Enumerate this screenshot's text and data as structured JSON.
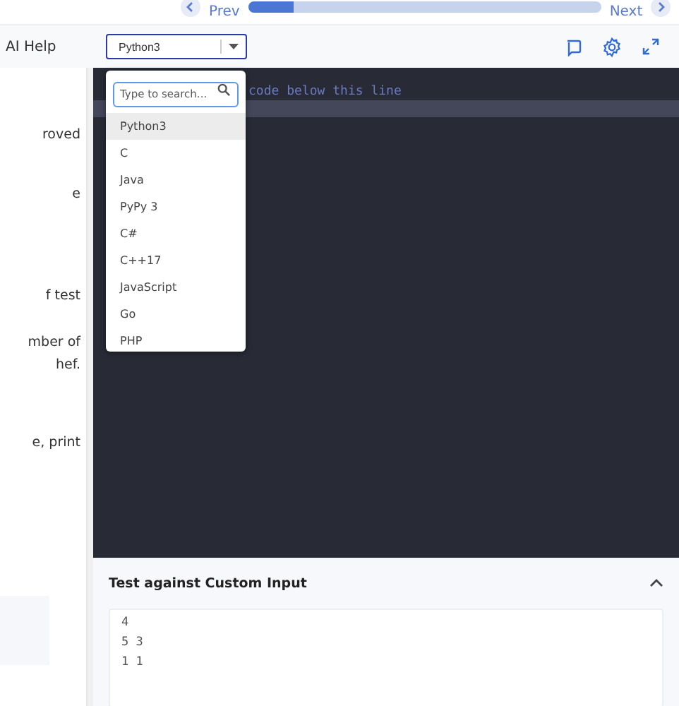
{
  "nav": {
    "prev": "Prev",
    "next": "Next",
    "progress": {
      "level": 0.13
    }
  },
  "header": {
    "ai_help": "AI Help",
    "language_select": {
      "value": "Python3"
    }
  },
  "problem_text": [
    "roved",
    "e",
    "f test",
    "mber of",
    "hef.",
    "e, print"
  ],
  "editor": {
    "lines": [
      {
        "text": "code below this line",
        "current": false
      },
      {
        "current": true
      }
    ]
  },
  "language_dropdown": {
    "search": {
      "placeholder": "Type to search..."
    },
    "options": [
      {
        "label": "Python3",
        "selected": true
      },
      {
        "label": "C",
        "selected": false
      },
      {
        "label": "Java",
        "selected": false
      },
      {
        "label": "PyPy 3",
        "selected": false
      },
      {
        "label": "C#",
        "selected": false
      },
      {
        "label": "C++17",
        "selected": false
      },
      {
        "label": "JavaScript",
        "selected": false
      },
      {
        "label": "Go",
        "selected": false
      },
      {
        "label": "PHP",
        "selected": false
      }
    ]
  },
  "custom_input": {
    "title": "Test against Custom Input",
    "expanded": true,
    "lines": [
      "4",
      "5 3",
      "1 1"
    ]
  }
}
